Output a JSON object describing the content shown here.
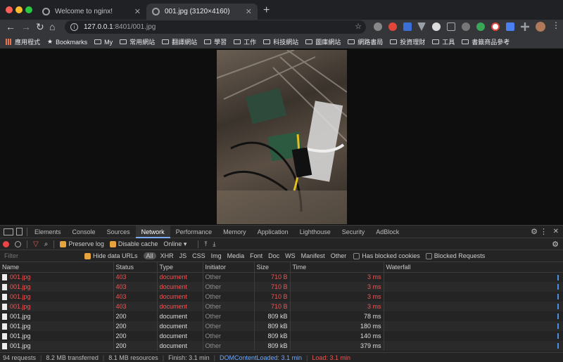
{
  "tabs": [
    {
      "title": "Welcome to nginx!",
      "close": "✕"
    },
    {
      "title": "001.jpg (3120×4160)",
      "close": "✕"
    }
  ],
  "new_tab": "+",
  "nav": {
    "back": "←",
    "forward": "→",
    "reload": "↻",
    "home": "⌂",
    "star": "☆"
  },
  "url": {
    "host": "127.0.0.1",
    "path": ":8401/001.jpg"
  },
  "bookmarks": [
    {
      "label": "應用程式",
      "icon": "apps-grid-icon"
    },
    {
      "label": "Bookmarks",
      "icon": "star-icon"
    },
    {
      "label": "My",
      "icon": "folder-icon"
    },
    {
      "label": "常用網站",
      "icon": "folder-icon"
    },
    {
      "label": "翻譯網站",
      "icon": "folder-icon"
    },
    {
      "label": "學習",
      "icon": "folder-icon"
    },
    {
      "label": "工作",
      "icon": "folder-icon"
    },
    {
      "label": "科技網站",
      "icon": "folder-icon"
    },
    {
      "label": "圖庫網站",
      "icon": "folder-icon"
    },
    {
      "label": "網路書局",
      "icon": "folder-icon"
    },
    {
      "label": "投資理財",
      "icon": "folder-icon"
    },
    {
      "label": "工具",
      "icon": "folder-icon"
    },
    {
      "label": "書籤商品參考",
      "icon": "folder-icon"
    }
  ],
  "devtools": {
    "tabs": [
      "Elements",
      "Console",
      "Sources",
      "Network",
      "Performance",
      "Memory",
      "Application",
      "Lighthouse",
      "Security",
      "AdBlock"
    ],
    "active_tab": "Network",
    "toolbar": {
      "preserve_log": "Preserve log",
      "disable_cache": "Disable cache",
      "throttle": "Online"
    },
    "filter": {
      "placeholder": "Filter",
      "hide_data_urls": "Hide data URLs",
      "types": [
        "All",
        "XHR",
        "JS",
        "CSS",
        "Img",
        "Media",
        "Font",
        "Doc",
        "WS",
        "Manifest",
        "Other"
      ],
      "has_blocked_cookies": "Has blocked cookies",
      "blocked_requests": "Blocked Requests"
    },
    "columns": [
      "Name",
      "Status",
      "Type",
      "Initiator",
      "Size",
      "Time",
      "Waterfall"
    ],
    "rows": [
      {
        "name": "001.jpg",
        "status": "403",
        "type": "document",
        "initiator": "Other",
        "size": "710 B",
        "time": "3 ms",
        "error": true
      },
      {
        "name": "001.jpg",
        "status": "403",
        "type": "document",
        "initiator": "Other",
        "size": "710 B",
        "time": "3 ms",
        "error": true
      },
      {
        "name": "001.jpg",
        "status": "403",
        "type": "document",
        "initiator": "Other",
        "size": "710 B",
        "time": "3 ms",
        "error": true
      },
      {
        "name": "001.jpg",
        "status": "403",
        "type": "document",
        "initiator": "Other",
        "size": "710 B",
        "time": "3 ms",
        "error": true
      },
      {
        "name": "001.jpg",
        "status": "200",
        "type": "document",
        "initiator": "Other",
        "size": "809 kB",
        "time": "78 ms",
        "error": false
      },
      {
        "name": "001.jpg",
        "status": "200",
        "type": "document",
        "initiator": "Other",
        "size": "809 kB",
        "time": "180 ms",
        "error": false
      },
      {
        "name": "001.jpg",
        "status": "200",
        "type": "document",
        "initiator": "Other",
        "size": "809 kB",
        "time": "140 ms",
        "error": false
      },
      {
        "name": "001.jpg",
        "status": "200",
        "type": "document",
        "initiator": "Other",
        "size": "809 kB",
        "time": "379 ms",
        "error": false
      }
    ],
    "status": {
      "requests": "94 requests",
      "transferred": "8.2 MB transferred",
      "resources": "8.1 MB resources",
      "finish": "Finish: 3.1 min",
      "dcl": "DOMContentLoaded: 3.1 min",
      "load": "Load: 3.1 min"
    }
  },
  "colors": {
    "error": "#ee5555",
    "accent": "#7cacf8",
    "checkbox": "#e8a33d"
  }
}
